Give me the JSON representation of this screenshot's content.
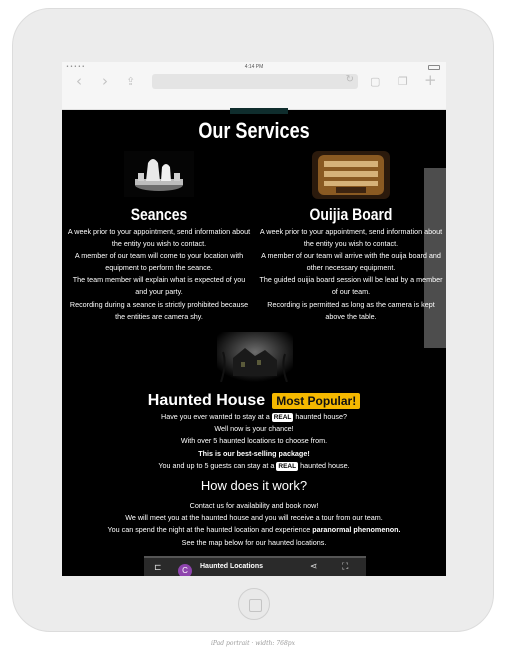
{
  "device": {
    "caption": "iPad portrait · width: 768px"
  },
  "browser": {
    "status_time": "4:14 PM",
    "icons": {
      "back": "chevron-left-icon",
      "forward": "chevron-right-icon",
      "share": "share-icon",
      "reload": "reload-icon",
      "bookmarks": "book-icon",
      "tabs": "tabs-icon",
      "new_tab": "plus-icon"
    }
  },
  "services": {
    "title": "Our Services",
    "seances": {
      "title": "Seances",
      "lines": [
        "A week prior to your appointment, send information about the entity you wish to contact.",
        "A member of our team will come to your location with equipment to perform the seance.",
        "The team member will explain what is expected of you and your party.",
        "Recording during a seance is strictly prohibited because the entities are camera shy."
      ]
    },
    "ouija": {
      "title": "Ouijia Board",
      "lines": [
        "A week prior to your appointment, send information about the entity you wish to contact.",
        "A member of our team wil arrive with the ouija board and other necessary equipment.",
        "The guided ouijia board session will be lead by a member of our team.",
        "Recording is permitted as long as the camera is kept above the table."
      ]
    }
  },
  "haunted": {
    "title": "Haunted House",
    "badge": "Most Popular!",
    "line1_pre": "Have you ever wanted to stay at a",
    "real_badge": "REAL",
    "line1_post": "haunted house?",
    "line2": "Well now is your chance!",
    "line3": "With over 5 haunted locations to choose from.",
    "line4": "This is our best-selling package!",
    "line5_pre": "You and up to 5 guests can stay at a",
    "line5_post": "haunted house."
  },
  "how": {
    "title": "How does it work?",
    "line1": "Contact us for availability and book now!",
    "line2": "We will meet you at the haunted house and you will receive a tour from our team.",
    "line3_pre": "You can spend the night at the haunted location and experience",
    "line3_bold": "paranormal phenomenon.",
    "line4": "See the map below for our haunted locations."
  },
  "map": {
    "avatar_letter": "C",
    "title": "Haunted Locations"
  }
}
